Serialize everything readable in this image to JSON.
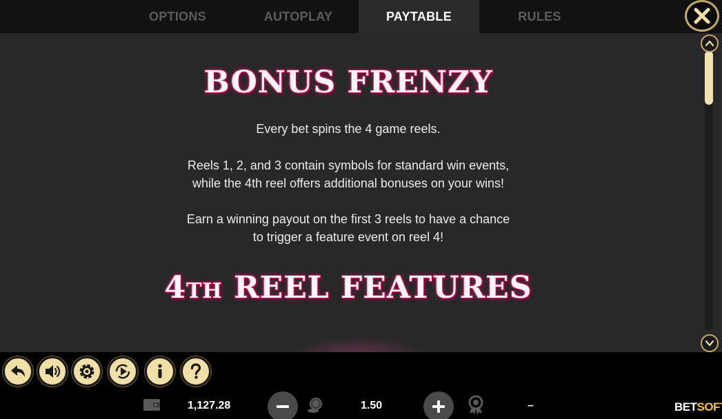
{
  "tabs": [
    {
      "label": "OPTIONS",
      "active": false
    },
    {
      "label": "AUTOPLAY",
      "active": false
    },
    {
      "label": "PAYTABLE",
      "active": true
    },
    {
      "label": "RULES",
      "active": false
    }
  ],
  "icons": {
    "close": "close-icon",
    "scroll_up": "chevron-up-icon",
    "scroll_down": "chevron-down-icon",
    "controls": [
      "back-icon",
      "sound-icon",
      "gear-icon",
      "autoplay-icon",
      "info-icon",
      "help-icon"
    ],
    "balance": "wallet-icon",
    "bet": "coins-icon",
    "win": "award-icon"
  },
  "content": {
    "title": "BONUS FRENZY",
    "para1": "Every bet spins the 4 game reels.",
    "para2_line1": "Reels 1, 2, and 3 contain symbols for standard win events,",
    "para2_line2": "while the 4th reel offers additional bonuses on your wins!",
    "para3_line1": "Earn a winning payout on the first 3 reels to have a chance",
    "para3_line2": "to trigger a feature event on reel 4!",
    "section_title_num": "4",
    "section_title_sup": "TH",
    "section_title_rest": " REEL FEATURES"
  },
  "footer": {
    "balance": "1,127.28",
    "bet": "1.50",
    "win": "–",
    "logo_part1": "BET",
    "logo_part2": "SOFT"
  },
  "colors": {
    "accent_gold": "#c6a96b",
    "button_cream": "#f1dfa8",
    "heading_pink": "#c2185b",
    "panel_bg": "#282828"
  }
}
